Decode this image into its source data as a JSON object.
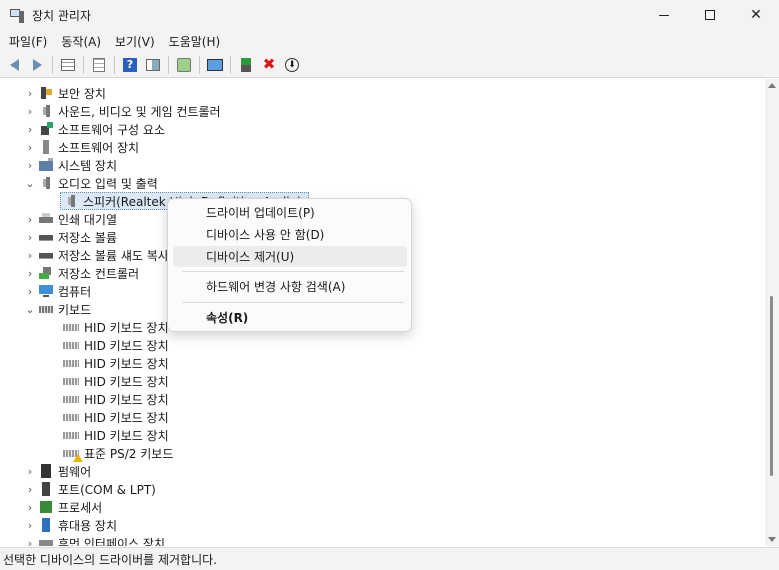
{
  "window": {
    "title": "장치 관리자"
  },
  "menu": [
    "파일(F)",
    "동작(A)",
    "보기(V)",
    "도움말(H)"
  ],
  "toolbar": {
    "icons": [
      "back-arrow",
      "forward-arrow",
      "properties-grid",
      "document",
      "help",
      "panel",
      "scan-hardware",
      "monitor",
      "update-driver",
      "uninstall",
      "download"
    ],
    "uninstall_color": "#dd1111"
  },
  "tree": {
    "items": [
      {
        "label": "보안 장치",
        "expanded": false
      },
      {
        "label": "사운드, 비디오 및 게임 컨트롤러",
        "expanded": false
      },
      {
        "label": "소프트웨어 구성 요소",
        "expanded": false
      },
      {
        "label": "소프트웨어 장치",
        "expanded": false
      },
      {
        "label": "시스템 장치",
        "expanded": false
      },
      {
        "label": "오디오 입력 및 출력",
        "expanded": true
      },
      {
        "label": "스피커(Realtek High Definition Audio)",
        "child": true,
        "selected": true
      },
      {
        "label": "인쇄 대기열",
        "expanded": false
      },
      {
        "label": "저장소 볼륨",
        "expanded": false
      },
      {
        "label": "저장소 볼륨 섀도 복사본",
        "expanded": false
      },
      {
        "label": "저장소 컨트롤러",
        "expanded": false
      },
      {
        "label": "컴퓨터",
        "expanded": false
      },
      {
        "label": "키보드",
        "expanded": true
      },
      {
        "label": "HID 키보드 장치",
        "child": true
      },
      {
        "label": "HID 키보드 장치",
        "child": true
      },
      {
        "label": "HID 키보드 장치",
        "child": true
      },
      {
        "label": "HID 키보드 장치",
        "child": true
      },
      {
        "label": "HID 키보드 장치",
        "child": true
      },
      {
        "label": "HID 키보드 장치",
        "child": true
      },
      {
        "label": "HID 키보드 장치",
        "child": true
      },
      {
        "label": "표준 PS/2 키보드",
        "child": true,
        "warning": true
      },
      {
        "label": "펌웨어",
        "expanded": false
      },
      {
        "label": "포트(COM & LPT)",
        "expanded": false
      },
      {
        "label": "프로세서",
        "expanded": false
      },
      {
        "label": "휴대용 장치",
        "expanded": false
      },
      {
        "label": "휴먼 인터페이스 장치",
        "expanded": false
      }
    ]
  },
  "context_menu": {
    "items": [
      {
        "label": "드라이버 업데이트(P)"
      },
      {
        "label": "디바이스 사용 안 함(D)"
      },
      {
        "label": "디바이스 제거(U)",
        "highlighted": true
      },
      {
        "label": "하드웨어 변경 사항 검색(A)"
      },
      {
        "label": "속성(R)",
        "bold": true
      }
    ]
  },
  "status": {
    "text": "선택한 디바이스의 드라이버를 제거합니다."
  }
}
